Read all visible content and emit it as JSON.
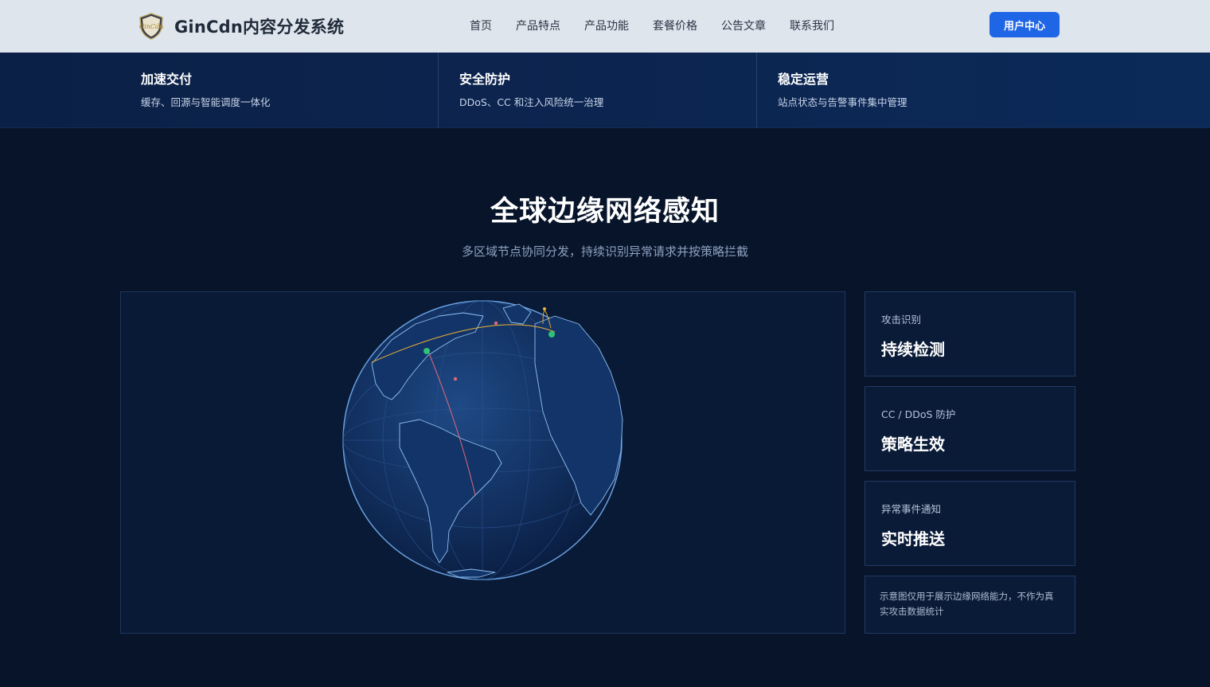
{
  "header": {
    "logo_text": "GinCdn",
    "brand": "GinCdn内容分发系统",
    "nav": [
      "首页",
      "产品特点",
      "产品功能",
      "套餐价格",
      "公告文章",
      "联系我们"
    ],
    "user_center": "用户中心"
  },
  "features": [
    {
      "title": "加速交付",
      "desc": "缓存、回源与智能调度一体化"
    },
    {
      "title": "安全防护",
      "desc": "DDoS、CC 和注入风险统一治理"
    },
    {
      "title": "稳定运营",
      "desc": "站点状态与告警事件集中管理"
    }
  ],
  "section": {
    "title": "全球边缘网络感知",
    "subtitle": "多区域节点协同分发，持续识别异常请求并按策略拦截"
  },
  "cards": [
    {
      "label": "攻击识别",
      "value": "持续检测"
    },
    {
      "label": "CC / DDoS 防护",
      "value": "策略生效"
    },
    {
      "label": "异常事件通知",
      "value": "实时推送"
    }
  ],
  "note": "示意图仅用于展示边缘网络能力，不作为真实攻击数据统计",
  "colors": {
    "header_bg": "#dfe5ec",
    "accent": "#1f66e6",
    "page_bg": "#07142a",
    "node_green": "#2fd27a",
    "arc_gold": "#d9a73a",
    "arc_red": "#e0687a"
  }
}
